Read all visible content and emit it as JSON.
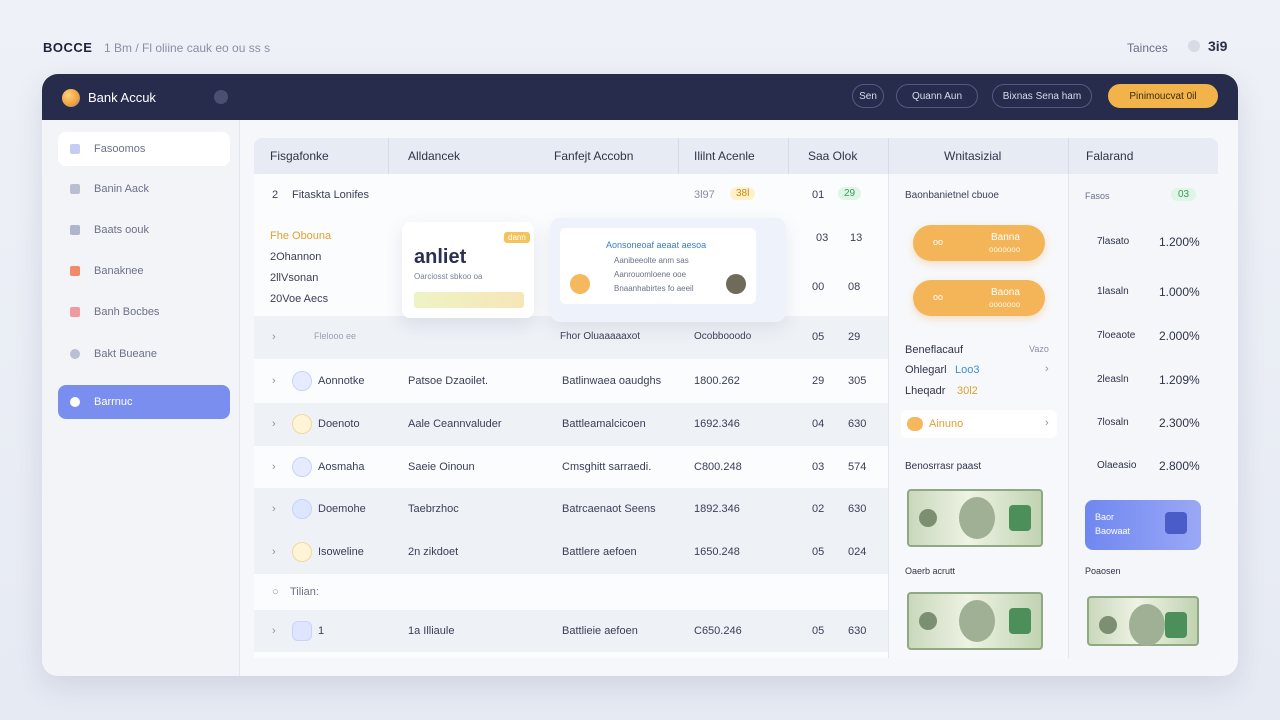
{
  "top": {
    "brand": "BOCCE",
    "breadcrumb": "1 Bm / Fl oliine cauk eo ou ss s",
    "right_label": "Tainces",
    "right_value": "3i9"
  },
  "header": {
    "app_name": "Bank Accuk",
    "buttons": [
      "Sen",
      "Quann Aun",
      "Bixnas Sena ham",
      "Pinimoucvat 0il"
    ]
  },
  "sidebar": {
    "items": [
      "Fasoomos",
      "Banin Aack",
      "Baats oouk",
      "Banaknee",
      "Banh Bocbes",
      "Bakt Bueane",
      "Barrnuc"
    ]
  },
  "table": {
    "headers": [
      "Fisgafonke",
      "Alldancek",
      "Fanfejt Accobn",
      "Ililnt Acenle",
      "Saa Olok",
      "Wnitasizial",
      "Falarand"
    ],
    "rows": [
      {
        "idx": "2",
        "name": "Fitaskta Lonifes",
        "account": "",
        "amount": "3l97",
        "amount_tag": "38l",
        "count": "01",
        "tag": "29"
      },
      {
        "idx": "",
        "name": "",
        "account": "",
        "amount": "",
        "count": "03",
        "tag": "13"
      },
      {
        "idx": "",
        "name": "",
        "account": "",
        "amount": "",
        "count": "00",
        "tag": "08"
      },
      {
        "idx": "",
        "name": "Flelooo ee",
        "account": "Fhor Oluaaaaaxot",
        "amount": "Ocobbooodo",
        "count": "05",
        "tag": "29"
      },
      {
        "idx": "",
        "name": "Aonnotke",
        "account": "Patsoe Dzaoilet.",
        "detail": "Batlinwaea oaudghs",
        "amount": "1800.262",
        "count": "29",
        "tag": "305"
      },
      {
        "idx": "",
        "name": "Doenoto",
        "account": "Aale Ceannvaluder",
        "detail": "Battleamalcicoen",
        "amount": "1692.346",
        "count": "04",
        "tag": "630"
      },
      {
        "idx": "",
        "name": "Aosmaha",
        "account": "Saeie Oinoun",
        "detail": "Cmsghitt sarraedi.",
        "amount": "C800.248",
        "count": "03",
        "tag": "574"
      },
      {
        "idx": "",
        "name": "Doemohe",
        "account": "Taebrzhoc",
        "detail": "Batrcaenaot Seens",
        "amount": "1892.346",
        "count": "02",
        "tag": "630"
      },
      {
        "idx": "",
        "name": "Isoweline",
        "account": "2n zikdoet",
        "detail": "Battlere aefoen",
        "amount": "1650.248",
        "count": "05",
        "tag": "024"
      }
    ],
    "group_label": "Tilian:",
    "last_row": {
      "name": "1",
      "account": "1a Illiaule",
      "detail": "Battlieie aefoen",
      "amount": "C650.246",
      "count": "05",
      "tag": "630"
    }
  },
  "popup": {
    "list": [
      "Fhe Obouna",
      "2Ohannon",
      "2llVsonan",
      "20Voe Aecs"
    ],
    "card_title": "anliet",
    "card_sub": "Oarciosst sbkoo oa",
    "card_badge": "dann",
    "info_title": "Aonsoneoaf aeaat aesoa",
    "info_lines": [
      "Aanibeeolte anm sas",
      "Aanrouomloene ooe",
      "Bnaanhabirtes fo aeeil"
    ]
  },
  "withdraw": {
    "header": "Baonbanietnel cbuoe",
    "pill1": {
      "left": "oo",
      "top": "Banna",
      "bottom": "ooooooo"
    },
    "pill2": {
      "left": "oo",
      "top": "Baona",
      "bottom": "ooooooo"
    },
    "summary": [
      {
        "label": "Beneflacauf",
        "value": "Vazo"
      },
      {
        "label": "Ohlegarl",
        "value": "Loo3"
      },
      {
        "label": "Lheqadr",
        "value": "30l2"
      }
    ],
    "badge_label": "Ainuno",
    "section": "Benosrrasr paast",
    "caption": "Oaerb acrutt"
  },
  "balance": {
    "header_item": "Fasos",
    "header_pill": "03",
    "rows": [
      {
        "label": "7lasato",
        "value": "1.200%"
      },
      {
        "label": "1lasaln",
        "value": "1.000%"
      },
      {
        "label": "7loeaote",
        "value": "2.000%"
      },
      {
        "label": "2leasln",
        "value": "1.209%"
      },
      {
        "label": "7losaln",
        "value": "2.300%"
      },
      {
        "label": "Olaeasio",
        "value": "2.800%"
      }
    ],
    "card": {
      "line1": "Baor",
      "line2": "Baowaat"
    },
    "caption": "Poaosen"
  },
  "colors": {
    "accent": "#7a8ef0",
    "header": "#272c4d",
    "orange": "#f2b44a",
    "green": "#4cb87a"
  }
}
